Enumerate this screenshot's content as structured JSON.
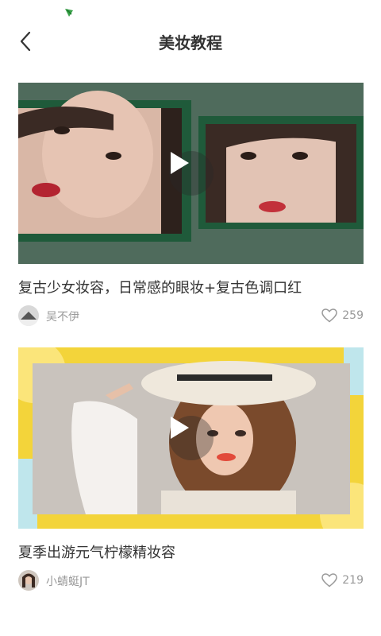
{
  "header": {
    "title": "美妆教程"
  },
  "colors": {
    "accent_green": "#1f6b43",
    "background": "#ffffff",
    "muted_text": "#999999"
  },
  "videos": [
    {
      "title": "复古少女妆容，日常感的眼妆+复古色调口红",
      "author": "吴不伊",
      "likes": "259"
    },
    {
      "title": "夏季出游元气柠檬精妆容",
      "author": "小蜻蜓JT",
      "likes": "219"
    }
  ]
}
